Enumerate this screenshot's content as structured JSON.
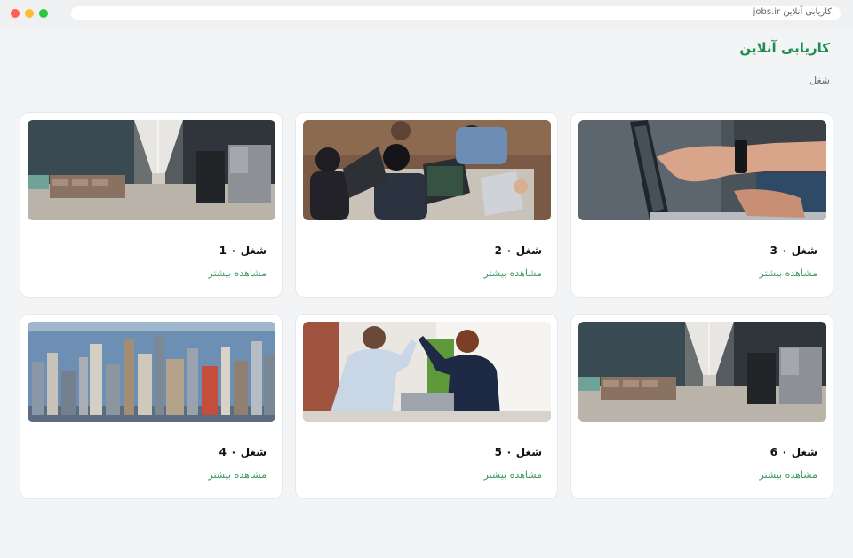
{
  "browser": {
    "url": "kariyabi-online.ir/jobs",
    "url_display": "jobs.ir کاریابی آنلاین",
    "dots": [
      "close",
      "minimize",
      "maximize"
    ]
  },
  "site": {
    "title": "کاریابی آنلاین",
    "breadcrumb": "شغل"
  },
  "cards": [
    {
      "title": "شغل ۰ 3",
      "link": "مشاهده بیشتر",
      "image": "hand-pointing-laptop-image"
    },
    {
      "title": "شغل ۰ 2",
      "link": "مشاهده بیشتر",
      "image": "team-working-laptops-image"
    },
    {
      "title": "شغل ۰ 1",
      "link": "مشاهده بیشتر",
      "image": "office-corridor-image"
    },
    {
      "title": "شغل ۰ 6",
      "link": "مشاهده بیشتر",
      "image": "office-corridor-image"
    },
    {
      "title": "شغل ۰ 5",
      "link": "مشاهده بیشتر",
      "image": "coworkers-high-five-image"
    },
    {
      "title": "شغل ۰ 4",
      "link": "مشاهده بیشتر",
      "image": "city-skyline-image"
    }
  ],
  "colors": {
    "accent": "#1e8e4d",
    "link": "#3a9a63",
    "background": "#f3f4f6"
  }
}
